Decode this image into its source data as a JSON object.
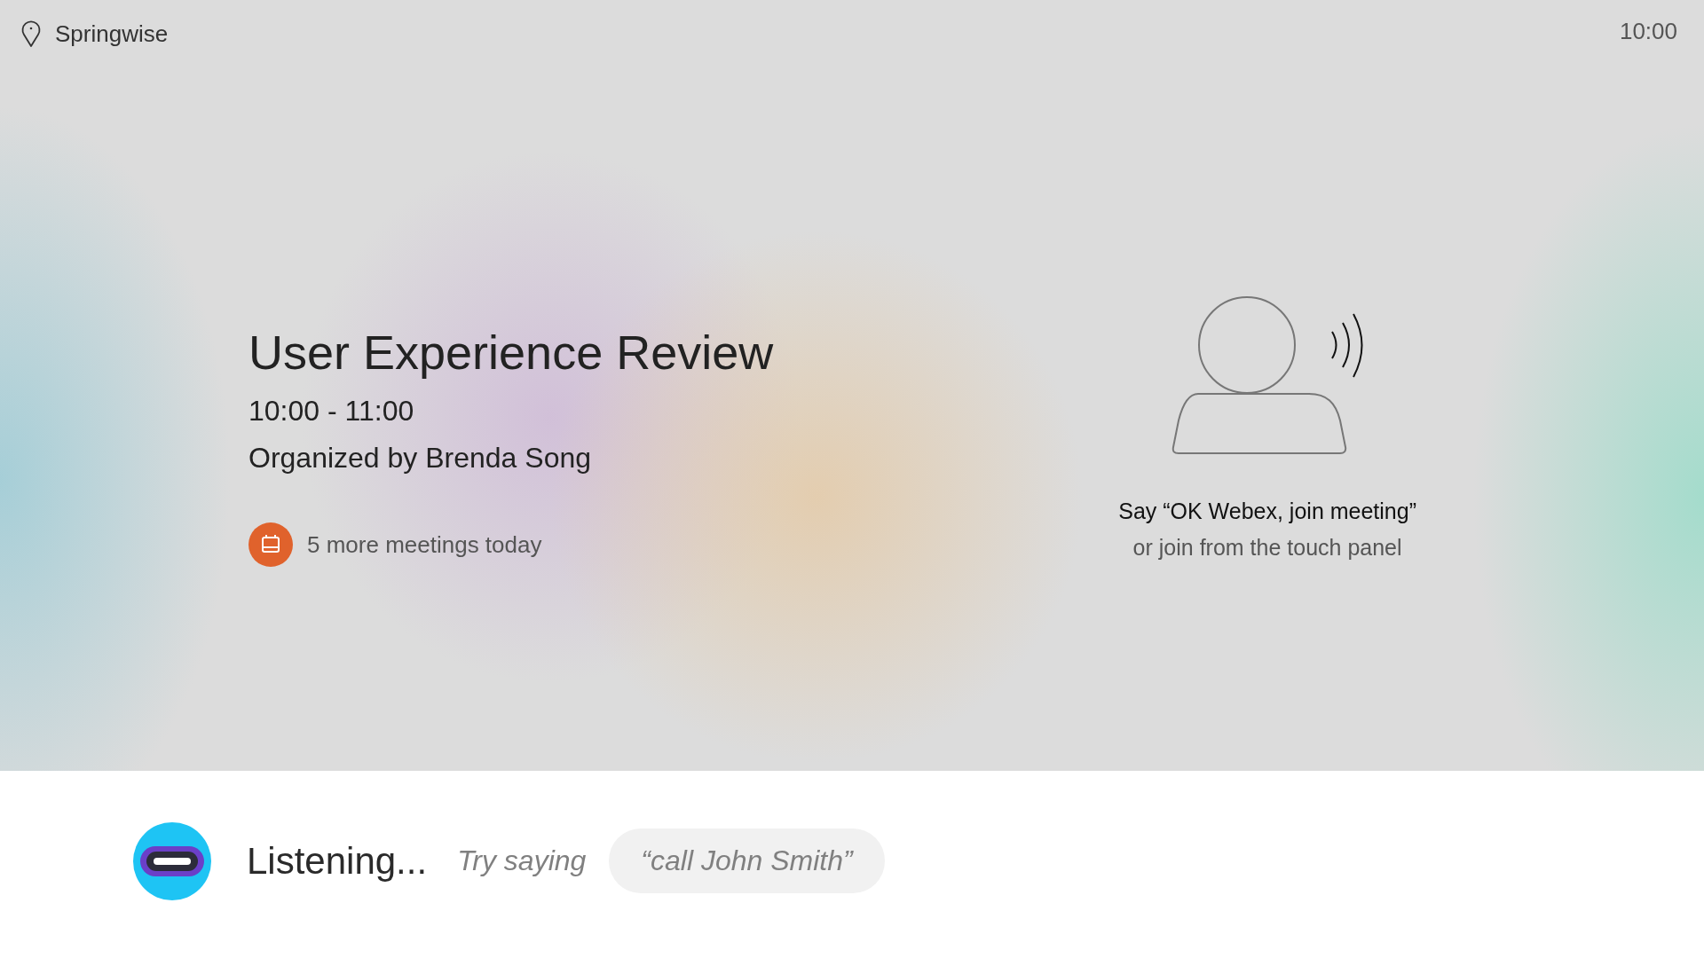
{
  "header": {
    "location": "Springwise",
    "time": "10:00"
  },
  "meeting": {
    "title": "User Experience Review",
    "time_range": "10:00 - 11:00",
    "organizer": "Organized by Brenda Song",
    "more_meetings": "5 more meetings today"
  },
  "join_prompt": {
    "instruction": "Say “OK Webex, join meeting”",
    "alternative": "or join from the touch panel"
  },
  "assistant": {
    "status": "Listening...",
    "hint_label": "Try saying",
    "suggestion": "“call John Smith”"
  }
}
